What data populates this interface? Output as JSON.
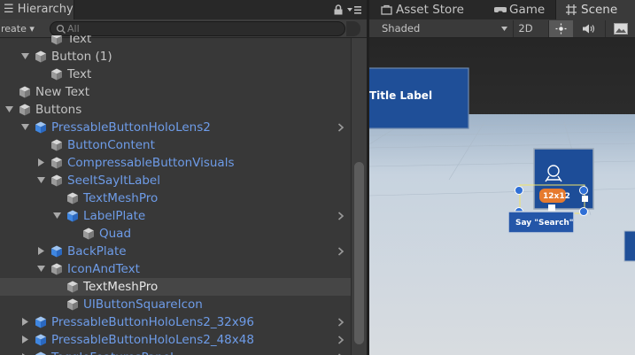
{
  "hierarchy": {
    "tab_label": "Hierarchy",
    "create_label": "reate",
    "search_placeholder": "All",
    "rows": [
      {
        "label": "Text",
        "level": 3,
        "fold": "none",
        "kind": "plain"
      },
      {
        "label": "Button (1)",
        "level": 2,
        "fold": "open",
        "kind": "plain"
      },
      {
        "label": "Text",
        "level": 3,
        "fold": "none",
        "kind": "plain"
      },
      {
        "label": "New Text",
        "level": 1,
        "fold": "none",
        "kind": "plain"
      },
      {
        "label": "Buttons",
        "level": 1,
        "fold": "open",
        "kind": "plain"
      },
      {
        "label": "PressableButtonHoloLens2",
        "level": 2,
        "fold": "open",
        "kind": "prefab",
        "chevron": true
      },
      {
        "label": "ButtonContent",
        "level": 3,
        "fold": "none",
        "kind": "prefab"
      },
      {
        "label": "CompressableButtonVisuals",
        "level": 3,
        "fold": "closed",
        "kind": "prefab"
      },
      {
        "label": "SeeItSayItLabel",
        "level": 3,
        "fold": "open",
        "kind": "prefab"
      },
      {
        "label": "TextMeshPro",
        "level": 4,
        "fold": "none",
        "kind": "prefab"
      },
      {
        "label": "LabelPlate",
        "level": 4,
        "fold": "open",
        "kind": "prefab",
        "cube": "blue",
        "chevron": true
      },
      {
        "label": "Quad",
        "level": 5,
        "fold": "none",
        "kind": "prefab"
      },
      {
        "label": "BackPlate",
        "level": 3,
        "fold": "closed",
        "kind": "prefab",
        "cube": "blue",
        "chevron": true
      },
      {
        "label": "IconAndText",
        "level": 3,
        "fold": "open",
        "kind": "prefab"
      },
      {
        "label": "TextMeshPro",
        "level": 4,
        "fold": "none",
        "kind": "selected"
      },
      {
        "label": "UIButtonSquareIcon",
        "level": 4,
        "fold": "none",
        "kind": "prefab"
      },
      {
        "label": "PressableButtonHoloLens2_32x96",
        "level": 2,
        "fold": "closed",
        "kind": "prefab",
        "cube": "blue",
        "chevron": true
      },
      {
        "label": "PressableButtonHoloLens2_48x48",
        "level": 2,
        "fold": "closed",
        "kind": "prefab",
        "cube": "blue",
        "chevron": true
      },
      {
        "label": "ToggleFeaturesPanel",
        "level": 2,
        "fold": "closed",
        "kind": "prefab",
        "cube": "blue",
        "chevron": true
      }
    ]
  },
  "scene": {
    "tabs": [
      {
        "label": "Asset Store",
        "icon": "asset-store-icon"
      },
      {
        "label": "Game",
        "icon": "game-icon"
      },
      {
        "label": "Scene",
        "icon": "scene-grid-icon",
        "active": true
      }
    ],
    "shading_mode": "Shaded",
    "mode_2d_label": "2D",
    "viewport": {
      "title_label_text": "Title Label",
      "button_label_text": "Say \"Search\"",
      "gizmo_readout": "12x12"
    }
  },
  "colors": {
    "prefab_text": "#6e9ce8",
    "plain_text": "#c4c4c4",
    "panel_bg": "#383838",
    "selected_row": "#464646",
    "scene_panel_blue": "#1f4f98",
    "gizmo_orange": "#e67a2e"
  }
}
